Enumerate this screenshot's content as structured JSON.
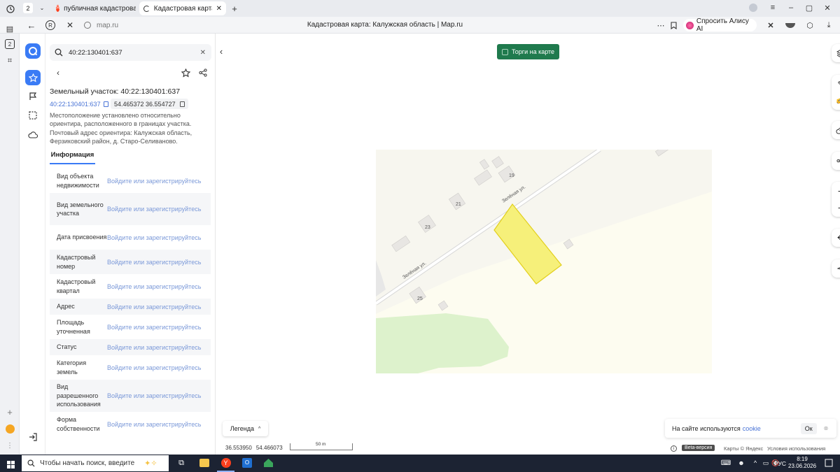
{
  "browser": {
    "tab_count": "2",
    "tabs": [
      {
        "label": "публичная кадастровая к"
      },
      {
        "label": "Кадастровая карта: Ка"
      }
    ],
    "address": "map.ru",
    "page_title": "Кадастровая карта: Калужская область | Map.ru",
    "alice_label": "Спросить Алису AI"
  },
  "panel": {
    "search_value": "40:22:130401:637",
    "title": "Земельный участок: 40:22:130401:637",
    "cadnum": "40:22:130401:637",
    "coords": "54.465372 36.554727",
    "description": "Местоположение установлено относительно ориентира, расположенного в границах участка. Почтовый адрес ориентира: Калужская область, Ферзиковский район, д. Старо-Селиваново.",
    "tab_label": "Информация",
    "login_text": "Войдите или зарегистрируйтесь",
    "rows": [
      {
        "key": "Вид объекта недвижимости"
      },
      {
        "key": "Вид земельного участка"
      },
      {
        "key": "Дата присвоения"
      },
      {
        "key": "Кадастровый номер"
      },
      {
        "key": "Кадастровый квартал"
      },
      {
        "key": "Адрес"
      },
      {
        "key": "Площадь уточненная"
      },
      {
        "key": "Статус"
      },
      {
        "key": "Категория земель"
      },
      {
        "key": "Вид разрешенного использования"
      },
      {
        "key": "Форма собственности"
      }
    ]
  },
  "map": {
    "auctions_label": "Торги на карте",
    "street_label": "Зелёная ул.",
    "house_numbers": [
      "19",
      "21",
      "23",
      "25"
    ],
    "legend_label": "Легенда",
    "cookie_text": "На сайте используются",
    "cookie_link": "cookie",
    "cookie_ok": "Ок",
    "cursor_lon": "36.553950",
    "cursor_lat": "54.466073",
    "scale_label": "50 m",
    "beta_label": "Beta-версия",
    "attribution": "Карты © Яндекс",
    "terms": "Условия использования",
    "parcel_color": "#f6f07a",
    "parcel_stroke": "#e2cf1c"
  },
  "taskbar": {
    "search_placeholder": "Чтобы начать поиск, введите",
    "lang": "РУС",
    "time": "8:19",
    "date": "23.06.2026"
  },
  "colors": {
    "accent": "#3a7bf5",
    "auction_green": "#1f7a4d",
    "link": "#7a98d8"
  }
}
